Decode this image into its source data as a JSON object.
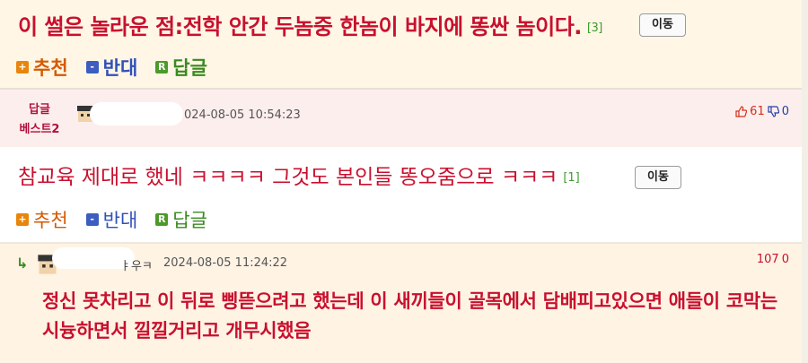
{
  "post": {
    "text": "이 썰은 놀라운 점:전학 안간 두놈중 한놈이 바지에 똥싼 놈이다.",
    "reply_count": "[3]",
    "move_label": "이동"
  },
  "actions": {
    "upvote_label": "추천",
    "downvote_label": "반대",
    "reply_label": "답글",
    "upvote_icon": "+",
    "downvote_icon": "-",
    "reply_icon": "R"
  },
  "comment1": {
    "badge_line1": "답글",
    "badge_line2": "베스트2",
    "date": "024-08-05 10:54:23",
    "up_count": "61",
    "down_count": "0",
    "text": "참교육 제대로 했네 ㅋㅋㅋㅋ 그것도 본인들 똥오줌으로 ㅋㅋㅋ",
    "reply_count": "[1]",
    "move_label": "이동"
  },
  "comment2": {
    "reply_arrow": "↳",
    "name_fragment": "ㅑ우ㅋ",
    "date": "2024-08-05 11:24:22",
    "up_count": "107",
    "down_count": "0",
    "text": "정신 못차리고 이 뒤로 삥뜯으려고 했는데 이 새끼들이 골목에서 담배피고있으면 애들이 코막는 시늉하면서 낄낄거리고 개무시했음"
  },
  "colors": {
    "accent_red": "#c8102e",
    "upvote_orange": "#e8860b",
    "downvote_blue": "#3d5ec0",
    "reply_green": "#4c9a2a"
  }
}
